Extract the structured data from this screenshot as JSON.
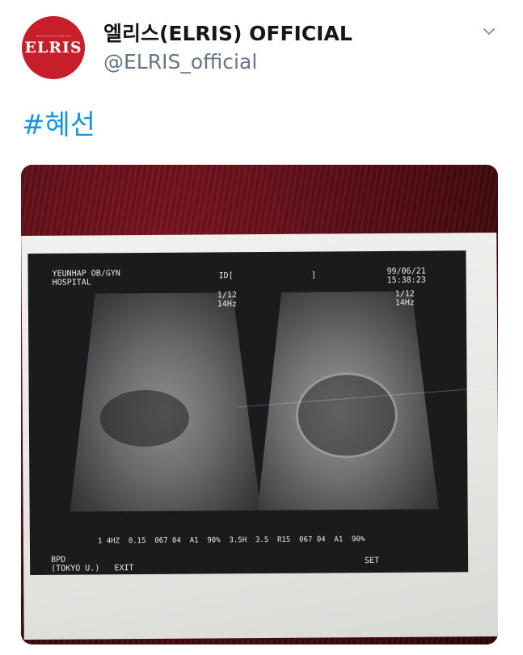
{
  "account": {
    "avatar_text": "ELRIS",
    "display_name": "엘리스(ELRIS) OFFICIAL",
    "handle": "@ELRIS_official"
  },
  "tweet": {
    "hashtag": "#혜선"
  },
  "photo": {
    "hospital": "YEUNHAP OB/GYN\nHOSPITAL",
    "id_line": "ID[                ]",
    "date_time": "99/06/21\n15:38:23",
    "frame_left": "1/12\n14Hz",
    "frame_right": "1/12\n14Hz",
    "measurements": "1 4HZ  0.15  067 04  A1  90%  3.5H  3.5  R15  067 04  A1  90%",
    "footer_left": "BPD\n(TOKYO U.)   EXIT",
    "footer_right": "SET"
  },
  "colors": {
    "avatar_bg": "#c81e29",
    "hashtag": "#1b95e0",
    "name": "#14171a",
    "handle": "#657786"
  }
}
